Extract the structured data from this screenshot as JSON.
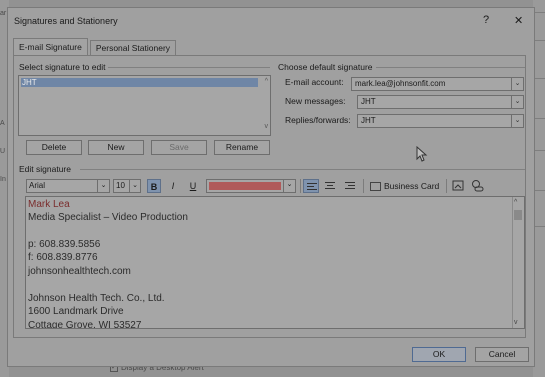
{
  "background": {
    "left_fragments": [
      "ar",
      "A",
      "U",
      "In"
    ],
    "bottom_checkbox_label": "Display a Desktop Alert"
  },
  "dialog": {
    "title": "Signatures and Stationery",
    "help_label": "?",
    "close_label": "✕"
  },
  "tabs": [
    {
      "label": "E-mail Signature",
      "active": true
    },
    {
      "label": "Personal Stationery",
      "active": false
    }
  ],
  "select_signature": {
    "label": "Select signature to edit",
    "items": [
      "JHT"
    ],
    "selected": "JHT"
  },
  "signature_buttons": {
    "delete": "Delete",
    "new": "New",
    "save": "Save",
    "rename": "Rename"
  },
  "default_signature": {
    "label": "Choose default signature",
    "email_account_label": "E-mail account:",
    "email_account_value": "mark.lea@johnsonfit.com",
    "new_messages_label": "New messages:",
    "new_messages_value": "JHT",
    "replies_label": "Replies/forwards:",
    "replies_value": "JHT"
  },
  "edit_signature": {
    "label": "Edit signature",
    "font": "Arial",
    "size": "10",
    "bold": "B",
    "italic": "I",
    "underline": "U",
    "font_color": "#b05a5a",
    "business_card": "Business Card",
    "lines": [
      "Mark Lea",
      "Media Specialist – Video Production",
      "",
      "p: 608.839.5856",
      "f: 608.839.8776",
      "johnsonhealthtech.com",
      "",
      "Johnson Health Tech. Co., Ltd.",
      "1600 Landmark Drive",
      "Cottage Grove, WI 53527"
    ]
  },
  "footer": {
    "ok": "OK",
    "cancel": "Cancel"
  },
  "colors": {
    "overlay_gray": "#a0a0a0",
    "selection": "#6f86a6",
    "name_color": "#7a2c2c"
  }
}
